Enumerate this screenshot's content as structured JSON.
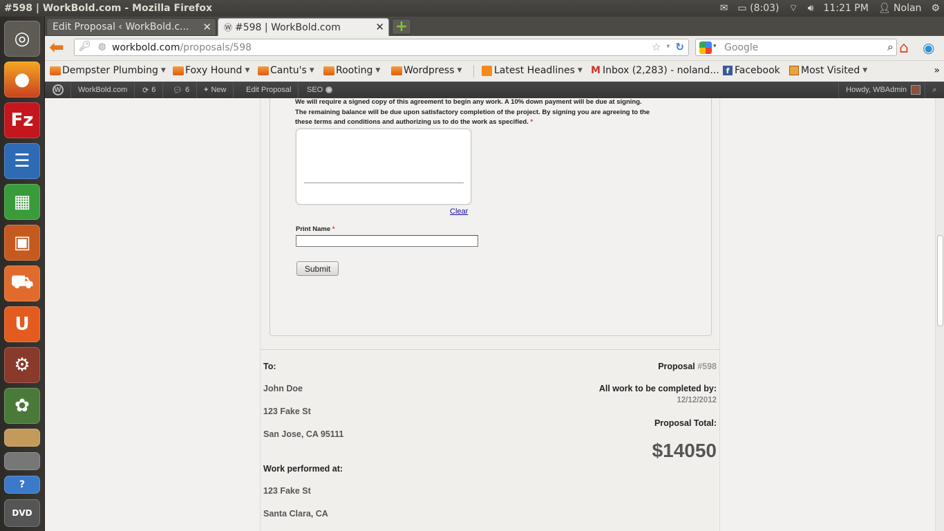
{
  "panel": {
    "window_title": "#598 | WorkBold.com - Mozilla Firefox",
    "battery": "(8:03)",
    "clock": "11:21 PM",
    "user": "Nolan"
  },
  "launcher": {
    "items": [
      "dash-icon",
      "firefox-icon",
      "filezilla-icon",
      "writer-icon",
      "calc-icon",
      "impress-icon",
      "software-center-icon",
      "ubuntu-one-icon",
      "system-settings-icon",
      "picasa-icon",
      "workspace-icon",
      "files-icon",
      "help-icon",
      "dvd-icon"
    ]
  },
  "tabs": [
    {
      "title": "Edit Proposal ‹ WorkBold.c...",
      "active": false
    },
    {
      "title": "#598 | WorkBold.com",
      "active": true
    }
  ],
  "navbar": {
    "url_host": "workbold.com",
    "url_path": "/proposals/598",
    "search_placeholder": "Google"
  },
  "bookmarks": [
    {
      "label": "Dempster Plumbing",
      "type": "folder"
    },
    {
      "label": "Foxy Hound",
      "type": "folder"
    },
    {
      "label": "Cantu's",
      "type": "folder"
    },
    {
      "label": "Rooting",
      "type": "folder"
    },
    {
      "label": "Wordpress",
      "type": "folder"
    },
    {
      "label": "Latest Headlines",
      "type": "rss"
    },
    {
      "label": "Inbox (2,283) - noland...",
      "type": "gmail"
    },
    {
      "label": "Facebook",
      "type": "facebook"
    },
    {
      "label": "Most Visited",
      "type": "folder"
    }
  ],
  "adminbar": {
    "site": "WorkBold.com",
    "updates": "6",
    "comments": "6",
    "new": "New",
    "edit": "Edit Proposal",
    "seo": "SEO",
    "howdy": "Howdy, WBAdmin"
  },
  "form": {
    "terms_line1": "We will require a signed copy of this agreement to begin any work. A 10% down payment will be due at signing.",
    "terms_line2": "The remaining balance will be due upon satisfactory completion of the project. By signing you are agreeing to the",
    "terms_line3": "these terms and conditions and authorizing us to do the work as specified.",
    "required_mark": "*",
    "clear_label": "Clear",
    "print_name_label": "Print Name",
    "print_name_value": "",
    "submit_label": "Submit"
  },
  "proposal": {
    "to_label": "To:",
    "client_name": "John Doe",
    "client_street": "123 Fake St",
    "client_city": "San Jose, CA 95111",
    "work_label": "Work performed at:",
    "work_street": "123 Fake St",
    "work_city": "Santa Clara, CA",
    "proposal_label": "Proposal",
    "proposal_number": "#598",
    "completed_label": "All work to be completed by:",
    "completed_date": "12/12/2012",
    "total_label": "Proposal Total:",
    "total_value": "$14050"
  },
  "colors": {
    "panel_bg": "#3c3b37",
    "admin_bar": "#464646",
    "page_bg": "#f2f1ef",
    "link": "#1a0dab",
    "required": "#dd3333"
  }
}
